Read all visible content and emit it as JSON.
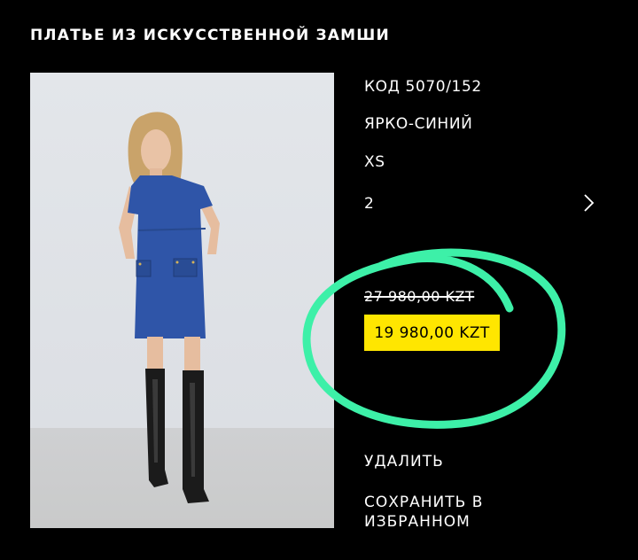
{
  "product": {
    "title": "ПЛАТЬЕ ИЗ ИСКУССТВЕННОЙ ЗАМШИ",
    "code": "КОД 5070/152",
    "color": "ЯРКО-СИНИЙ",
    "size": "XS",
    "quantity": "2",
    "old_price": "27 980,00 KZT",
    "new_price": "19 980,00 KZT"
  },
  "actions": {
    "delete": "УДАЛИТЬ",
    "save_line1": "СОХРАНИТЬ В",
    "save_line2": "ИЗБРАННОМ"
  },
  "colors": {
    "background": "#000000",
    "price_highlight": "#ffe600",
    "annotation_circle": "#3df0a8",
    "dress": "#2f55a8"
  },
  "icons": {
    "quantity_chevron": "chevron-right-icon"
  }
}
